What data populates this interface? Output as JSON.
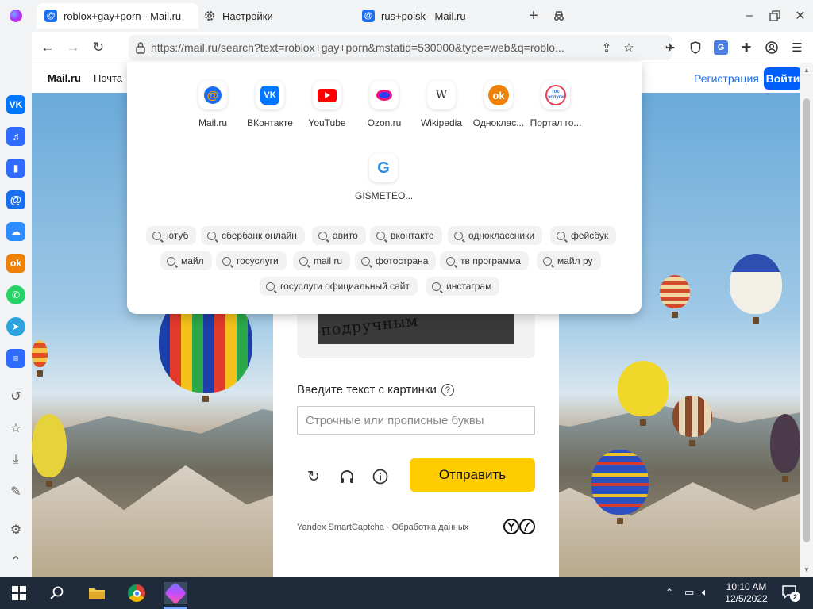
{
  "browser": {
    "tabs": [
      {
        "title": "roblox+gay+porn - Mail.ru",
        "active": true
      },
      {
        "title": "Настройки",
        "active": false
      },
      {
        "title": "rus+poisk - Mail.ru",
        "active": false
      }
    ],
    "url": "https://mail.ru/search?text=roblox+gay+porn&mstatid=530000&type=web&q=roblo..."
  },
  "mailbar": {
    "logo": "Mail.ru",
    "pochta": "Почта",
    "register": "Регистрация",
    "login": "Войти"
  },
  "dropdown": {
    "sites": [
      {
        "name": "Mail.ru",
        "color": "#1a6ef0"
      },
      {
        "name": "ВКонтакте",
        "color": "#0077ff"
      },
      {
        "name": "YouTube",
        "color": "#ff0000"
      },
      {
        "name": "Ozon.ru",
        "color": "#f1117e"
      },
      {
        "name": "Wikipedia",
        "color": "#333333"
      },
      {
        "name": "Одноклас...",
        "color": "#ee8208"
      },
      {
        "name": "Портал го...",
        "color": "#2f6bbf"
      },
      {
        "name": "GISMETEO...",
        "color": "#2b8de0"
      }
    ],
    "suggestions_row1": [
      "ютуб",
      "сбербанк онлайн",
      "авито",
      "вконтакте",
      "одноклассники",
      "фейсбук"
    ],
    "suggestions_row2": [
      "майл",
      "госуслуги",
      "mail ru",
      "фотострана",
      "тв программа",
      "майл ру"
    ],
    "suggestions_row3": [
      "госуслуги официальный сайт",
      "инстаграм"
    ]
  },
  "captcha": {
    "image_text": "подручным",
    "label": "Введите текст с картинки",
    "input_placeholder": "Строчные или прописные буквы",
    "submit": "Отправить",
    "footer": "Yandex SmartCaptcha · Обработка данных"
  },
  "taskbar": {
    "time": "10:10 AM",
    "date": "12/5/2022",
    "notifications": "2"
  }
}
